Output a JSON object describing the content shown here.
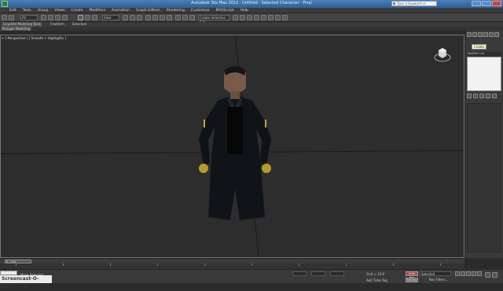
{
  "window": {
    "title": "Autodesk 3ds Max 2011 · Untitled · Selected Character · Final",
    "search_placeholder": "Type a keyword or phrase"
  },
  "menu": [
    "Edit",
    "Tools",
    "Group",
    "Views",
    "Create",
    "Modifiers",
    "Animation",
    "Graph Editors",
    "Rendering",
    "Customize",
    "MAXScript",
    "Help"
  ],
  "toolbar": {
    "selection_filter": "All",
    "reference_coord": "View",
    "named_selection": "Create Selection Set"
  },
  "ribbon": {
    "tabs": [
      "Graphite Modeling Tools",
      "Freeform",
      "Selection"
    ],
    "sub_label": "Polygon Modeling"
  },
  "viewport": {
    "label": "+ ] Perspective ] [ Smooth + Highlights ]"
  },
  "command_panel": {
    "tooltip": "Create",
    "modifier_list_label": "Modifier List"
  },
  "timeline": {
    "frame": "0 / 100"
  },
  "status": {
    "selection": "None Selected",
    "grid": "Grid = 10.0",
    "auto_key": "Auto Key",
    "set_key": "Set Key",
    "selected": "Selected",
    "key_filters": "Key Filters...",
    "add_time_tag": "Add Time Tag"
  },
  "watermark": "Screencast-O-Matic.com",
  "colors": {
    "titlebar": "#3a6fa8",
    "viewport_bg": "#2d2d2d",
    "panel_bg": "#3a3a3a",
    "auto_key_active": "#b04848"
  }
}
